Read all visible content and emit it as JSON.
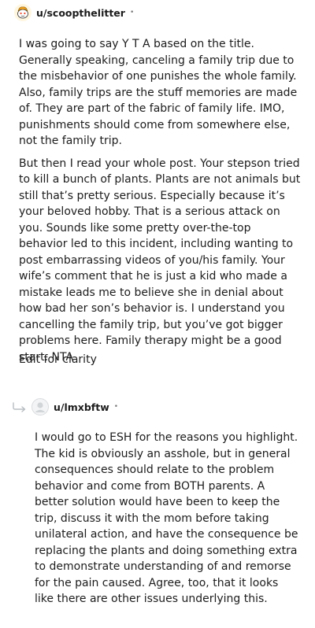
{
  "comments": [
    {
      "username": "u/scoopthelitter",
      "separator": "•",
      "paragraphs": [
        "I was going to say Y T A based on the title. Generally speaking, canceling a family trip due to the misbehavior of one punishes the whole family. Also, family trips are the stuff memories are made of. They are part of the fabric of family life. IMO, punishments should come from somewhere else, not the family trip.",
        "But then I read your whole post. Your stepson tried to kill a bunch of plants. Plants are not animals but still that’s pretty serious. Especially because it’s your beloved hobby. That is a serious attack on you. Sounds like some pretty over-the-top behavior led to this incident, including wanting to post embarrassing videos of you/his family. Your wife’s comment that he is just a kid who made a mistake leads me to believe she in denial about how bad her son’s behavior is. I understand you cancelling the family trip, but you’ve got bigger problems here. Family therapy might be a good start. NTA"
      ],
      "edit_note": "Edit for clarity",
      "avatar_icon": "snoo-avatar-icon"
    },
    {
      "username": "u/lmxbftw",
      "separator": "•",
      "paragraphs": [
        "I would go to ESH for the reasons you highlight. The kid is obviously an asshole, but in general consequences should relate to the problem behavior and come from BOTH parents. A better solution would have been to keep the trip, discuss it with the mom before taking unilateral action, and have the consequence be replacing the plants and doing something extra to demonstrate understanding of and remorse for the pain caused. Agree, too, that it looks like there are other issues underlying this."
      ],
      "avatar_icon": "default-avatar-icon",
      "reply_icon": "reply-arrow-icon"
    }
  ]
}
